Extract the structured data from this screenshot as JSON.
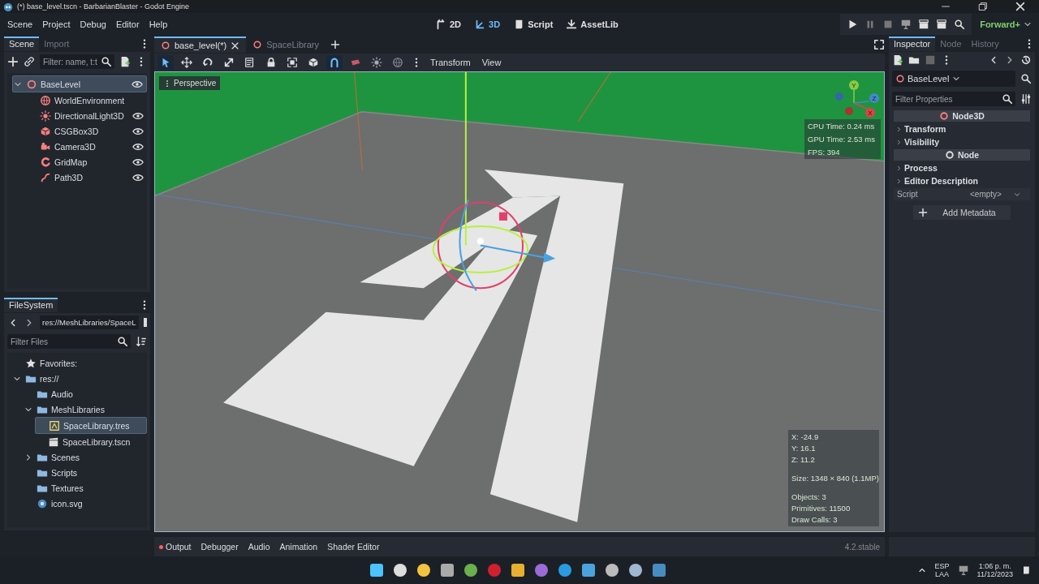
{
  "window": {
    "title": "(*) base_level.tscn - BarbarianBlaster - Godot Engine"
  },
  "menu": [
    "Scene",
    "Project",
    "Debug",
    "Editor",
    "Help"
  ],
  "workspaces": [
    {
      "label": "2D",
      "kind": "flat",
      "selected": false
    },
    {
      "label": "3D",
      "kind": "spatial",
      "selected": true
    },
    {
      "label": "Script",
      "kind": "script",
      "selected": false
    },
    {
      "label": "AssetLib",
      "kind": "assetlib",
      "selected": false
    }
  ],
  "renderer": "Forward+",
  "scene_dock": {
    "tabs": [
      {
        "label": "Scene",
        "selected": true
      },
      {
        "label": "Import",
        "selected": false
      }
    ],
    "filter": {
      "placeholder": "Filter: name, t:t"
    },
    "tree": [
      {
        "label": "BaseLevel",
        "kind": "node3d",
        "selected": true,
        "expanded": true,
        "visible": true,
        "children": [
          {
            "label": "WorldEnvironment",
            "kind": "environment",
            "selected": false
          },
          {
            "label": "DirectionalLight3D",
            "kind": "light",
            "selected": false,
            "visible": true
          },
          {
            "label": "CSGBox3D",
            "kind": "box",
            "selected": false,
            "visible": true
          },
          {
            "label": "Camera3D",
            "kind": "camera",
            "selected": false,
            "visible": true
          },
          {
            "label": "GridMap",
            "kind": "gridmap",
            "selected": false,
            "visible": true
          },
          {
            "label": "Path3D",
            "kind": "path",
            "selected": false,
            "visible": true
          }
        ]
      }
    ]
  },
  "filesystem": {
    "tab": "FileSystem",
    "path": "res://MeshLibraries/SpaceL",
    "filter": {
      "placeholder": "Filter Files"
    },
    "tree": [
      {
        "label": "Favorites:",
        "kind": "favorites",
        "selected": false
      },
      {
        "label": "res://",
        "kind": "folder",
        "selected": false,
        "expanded": true,
        "children": [
          {
            "label": "Audio",
            "kind": "folder",
            "selected": false
          },
          {
            "label": "MeshLibraries",
            "kind": "folder",
            "selected": false,
            "expanded": true,
            "children": [
              {
                "label": "SpaceLibrary.tres",
                "kind": "resource",
                "selected": true
              },
              {
                "label": "SpaceLibrary.tscn",
                "kind": "scene",
                "selected": false
              }
            ]
          },
          {
            "label": "Scenes",
            "kind": "folder",
            "selected": false,
            "expanded": false
          },
          {
            "label": "Scripts",
            "kind": "folder",
            "selected": false
          },
          {
            "label": "Textures",
            "kind": "folder",
            "selected": false
          },
          {
            "label": "icon.svg",
            "kind": "image",
            "selected": false
          }
        ]
      }
    ]
  },
  "editor_tabs": [
    {
      "label": "base_level(*)",
      "selected": true
    },
    {
      "label": "SpaceLibrary",
      "selected": false
    }
  ],
  "viewport_tools": [
    {
      "kind": "select",
      "selected": true
    },
    {
      "kind": "move",
      "selected": false
    },
    {
      "kind": "rotate",
      "selected": false
    },
    {
      "kind": "scale",
      "selected": false
    },
    {
      "kind": "list",
      "selected": false
    },
    {
      "kind": "lock",
      "selected": false
    },
    {
      "kind": "group",
      "selected": false
    },
    {
      "kind": "cube",
      "selected": false
    },
    {
      "kind": "snap",
      "selected": true
    },
    {
      "kind": "preview",
      "selected": false
    },
    {
      "kind": "sun",
      "selected": false
    },
    {
      "kind": "globe",
      "selected": false
    }
  ],
  "viewport_menus": [
    "Transform",
    "View"
  ],
  "viewport": {
    "view_button": "Perspective",
    "axes": [
      "Y",
      "Z",
      "X"
    ],
    "stats": [
      "CPU Time: 0.24 ms",
      "GPU Time: 2.53 ms",
      "FPS: 394"
    ],
    "info": [
      [
        "X: -24.9",
        "Y: 16.1",
        "Z: 11.2"
      ],
      [
        "Size: 1348 × 840 (1.1MP)"
      ],
      [
        "Objects: 3",
        "Primitives: 11500",
        "Draw Calls: 3"
      ]
    ]
  },
  "bottom_tabs": [
    {
      "label": "Output",
      "alert": true
    },
    {
      "label": "Debugger",
      "alert": false
    },
    {
      "label": "Audio",
      "alert": false
    },
    {
      "label": "Animation",
      "alert": false
    },
    {
      "label": "Shader Editor",
      "alert": false
    }
  ],
  "version": "4.2.stable",
  "inspector": {
    "tabs": [
      {
        "label": "Inspector",
        "selected": true
      },
      {
        "label": "Node",
        "selected": false
      },
      {
        "label": "History",
        "selected": false
      }
    ],
    "node": "BaseLevel",
    "filter": {
      "placeholder": "Filter Properties"
    },
    "rows": [
      {
        "kind": "category",
        "label": "Node3D",
        "color": "#fc7f7f"
      },
      {
        "kind": "group",
        "label": "Transform"
      },
      {
        "kind": "group",
        "label": "Visibility"
      },
      {
        "kind": "category",
        "label": "Node",
        "color": "#e0e0e0"
      },
      {
        "kind": "group",
        "label": "Process"
      },
      {
        "kind": "group",
        "label": "Editor Description"
      },
      {
        "kind": "property",
        "label": "Script",
        "value": "<empty>"
      }
    ],
    "add_button": "Add Metadata"
  },
  "taskbar": {
    "language": [
      "ESP",
      "LAA"
    ],
    "time": "1:06 p. m.",
    "date": "11/12/2023"
  }
}
